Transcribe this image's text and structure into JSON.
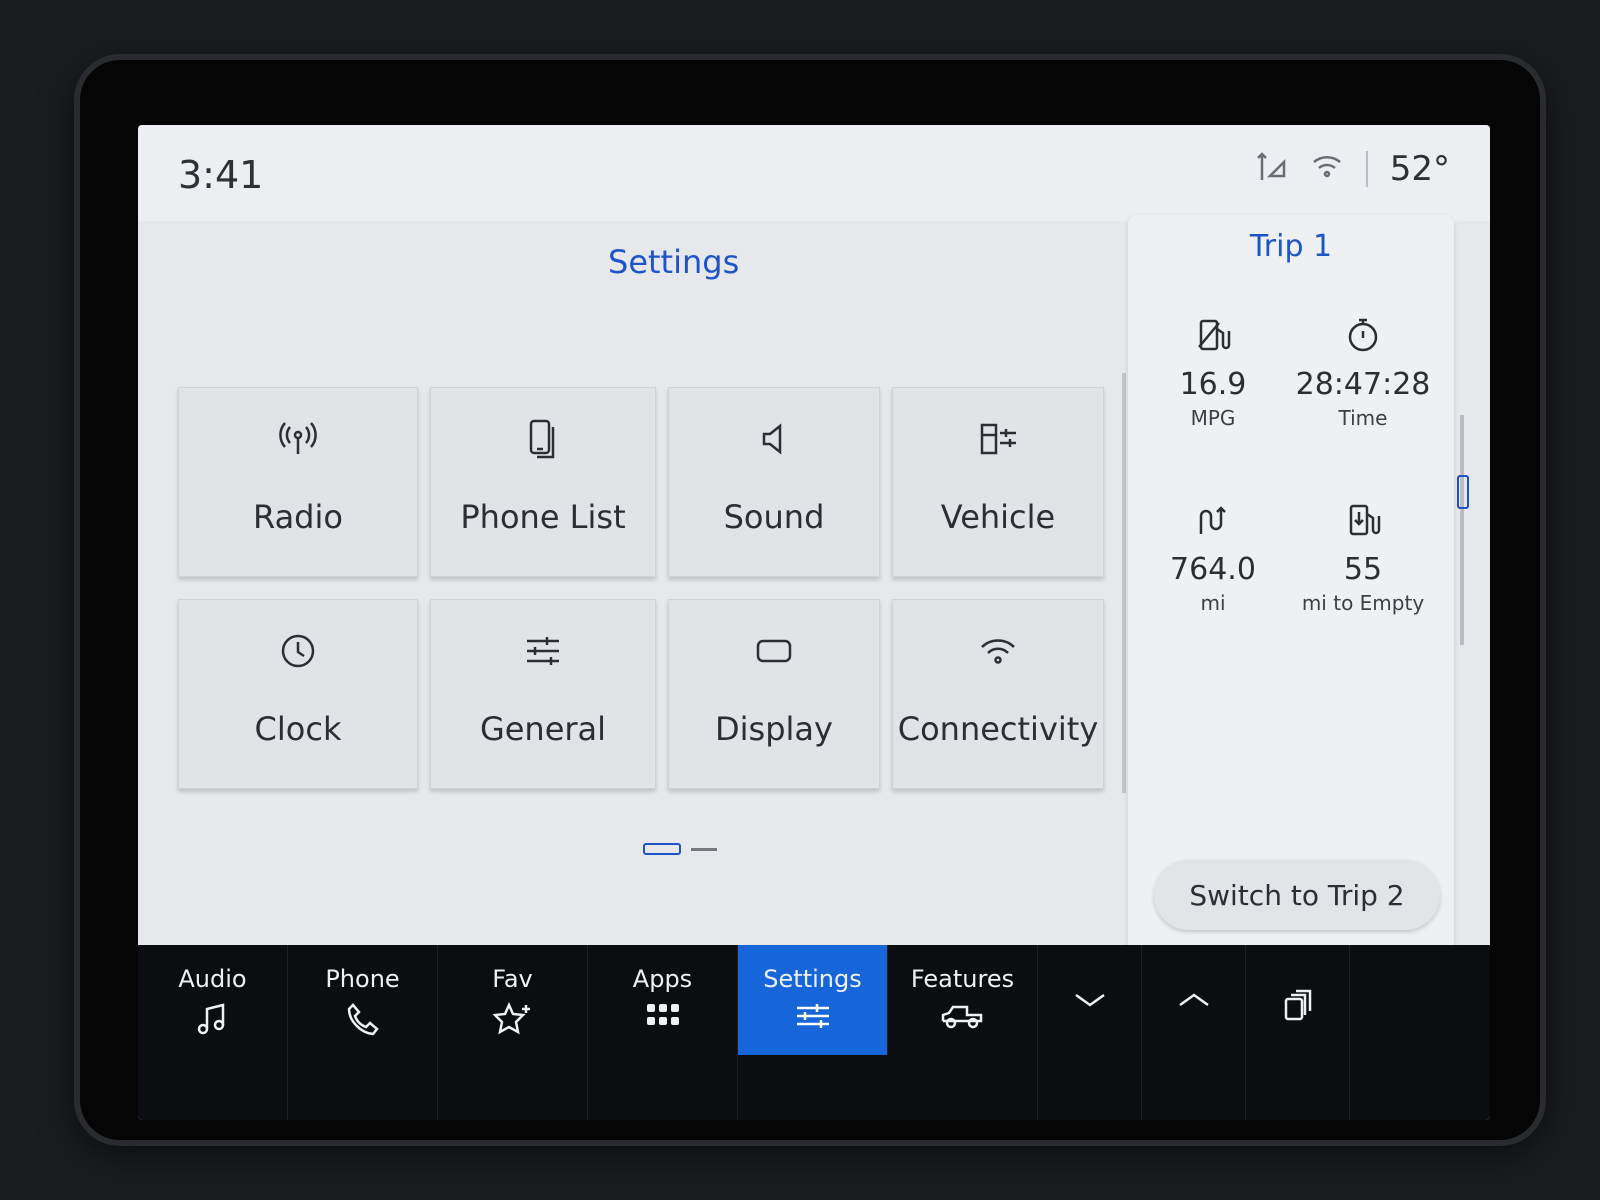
{
  "status": {
    "time": "3:41",
    "temperature": "52°"
  },
  "settings": {
    "title": "Settings",
    "tiles": [
      {
        "label": "Radio",
        "icon": "radio-antenna-icon"
      },
      {
        "label": "Phone List",
        "icon": "phone-list-icon"
      },
      {
        "label": "Sound",
        "icon": "speaker-icon"
      },
      {
        "label": "Vehicle",
        "icon": "vehicle-settings-icon"
      },
      {
        "label": "Clock",
        "icon": "clock-icon"
      },
      {
        "label": "General",
        "icon": "sliders-icon"
      },
      {
        "label": "Display",
        "icon": "display-icon"
      },
      {
        "label": "Connectivity",
        "icon": "wifi-icon"
      }
    ]
  },
  "trip": {
    "title": "Trip 1",
    "mpg_value": "16.9",
    "mpg_label": "MPG",
    "time_value": "28:47:28",
    "time_label": "Time",
    "distance_value": "764.0",
    "distance_label": "mi",
    "range_value": "55",
    "range_label": "mi to Empty",
    "switch_label": "Switch to Trip 2"
  },
  "nav": {
    "items": [
      {
        "label": "Audio",
        "icon": "music-note-icon"
      },
      {
        "label": "Phone",
        "icon": "phone-handset-icon"
      },
      {
        "label": "Fav",
        "icon": "star-plus-icon"
      },
      {
        "label": "Apps",
        "icon": "apps-grid-icon"
      },
      {
        "label": "Settings",
        "icon": "sliders-icon"
      },
      {
        "label": "Features",
        "icon": "truck-icon"
      }
    ],
    "active": "Settings"
  },
  "colors": {
    "accent": "#1d55c8",
    "nav_active": "#1666d9",
    "screen_bg": "#e7e8eb",
    "nav_bg": "#0c0d10"
  }
}
